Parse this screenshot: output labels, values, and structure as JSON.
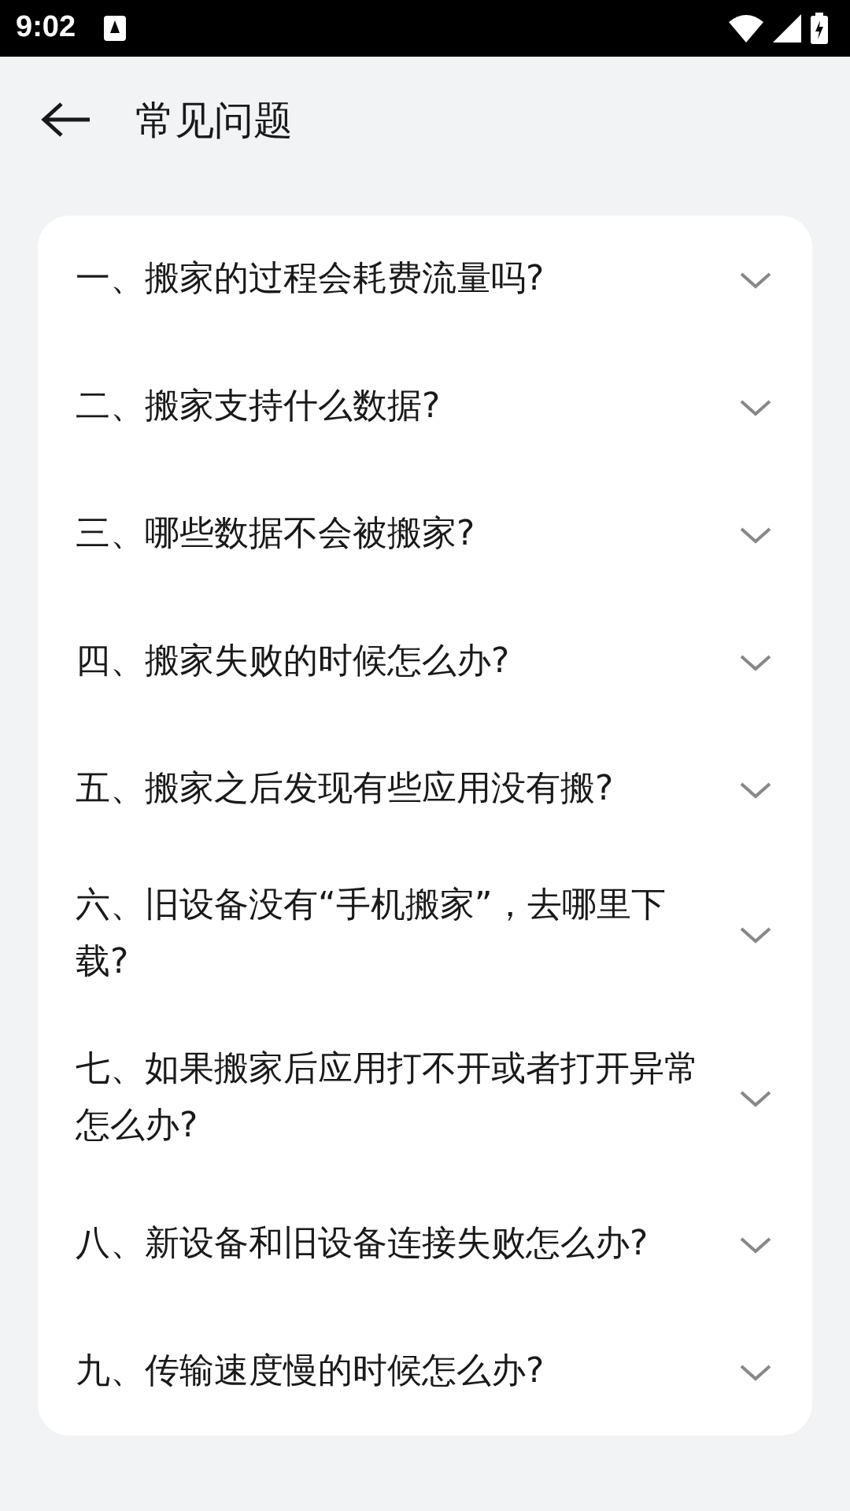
{
  "status_bar": {
    "time": "9:02"
  },
  "header": {
    "title": "常见问题"
  },
  "faq": [
    {
      "question": "一、搬家的过程会耗费流量吗?",
      "expanded": false
    },
    {
      "question": "二、搬家支持什么数据?",
      "expanded": false
    },
    {
      "question": "三、哪些数据不会被搬家?",
      "expanded": false
    },
    {
      "question": "四、搬家失败的时候怎么办?",
      "expanded": false
    },
    {
      "question": "五、搬家之后发现有些应用没有搬?",
      "expanded": false
    },
    {
      "question": "六、旧设备没有“手机搬家”，去哪里下载?",
      "expanded": false
    },
    {
      "question": "七、如果搬家后应用打不开或者打开异常怎么办?",
      "expanded": false
    },
    {
      "question": "八、新设备和旧设备连接失败怎么办?",
      "expanded": false
    },
    {
      "question": "九、传输速度慢的时候怎么办?",
      "expanded": false
    }
  ]
}
